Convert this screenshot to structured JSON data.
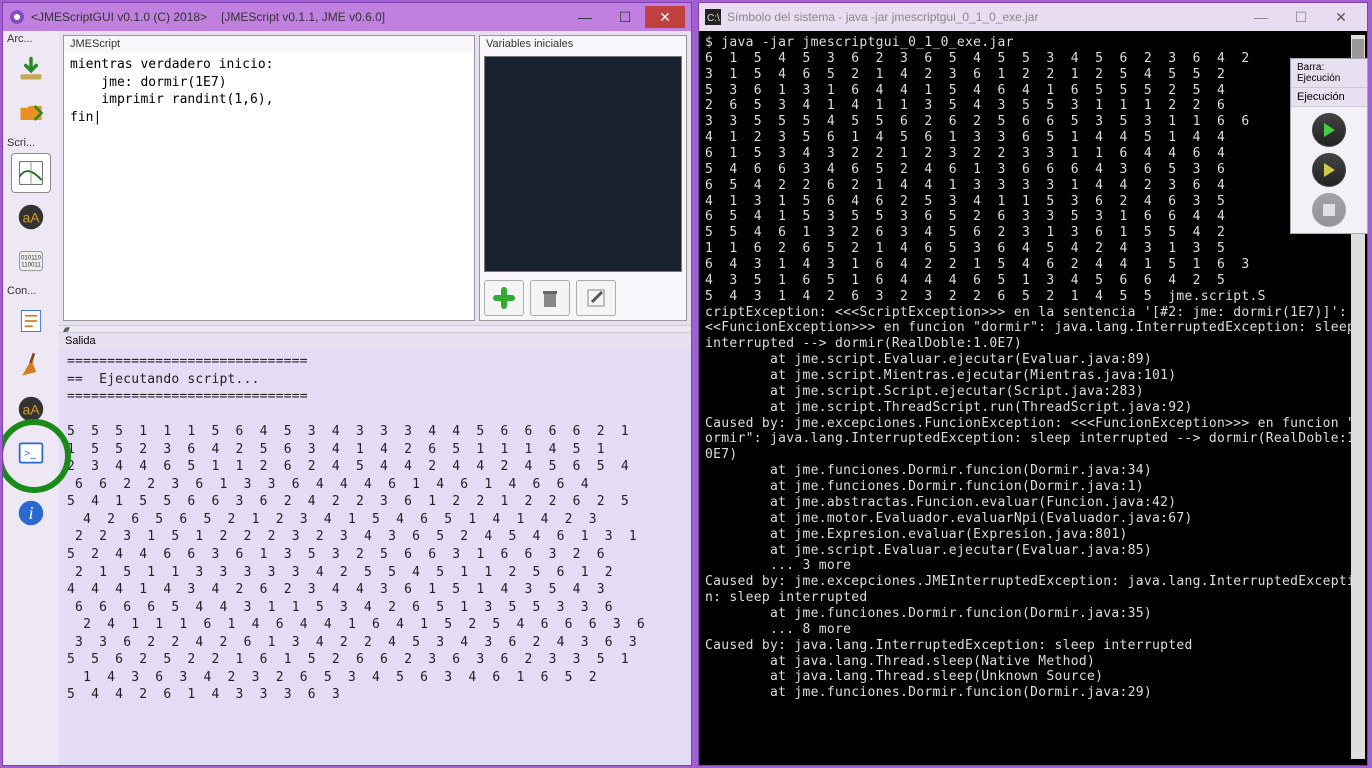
{
  "main_window": {
    "title_left": "<JMEScriptGUI v0.1.0 (C) 2018>",
    "title_right": "[JMEScript v0.1.1, JME v0.6.0]"
  },
  "toolbar": {
    "sec_arc": "Arc...",
    "sec_scri": "Scri...",
    "sec_con": "Con..."
  },
  "code_panel": {
    "label": "JMEScript",
    "content": "mientras verdadero inicio:\n    jme: dormir(1E7)\n    imprimir randint(1,6),\nfin|"
  },
  "vars_panel": {
    "label": "Variables iniciales"
  },
  "output_panel": {
    "label": "Salida",
    "content": "==============================\n==  Ejecutando script...\n==============================\n\n5  5  5  1  1  1  5  6  4  5  3  4  3  3  3  4  4  5  6  6  6  6  2  1\n1  5  5  2  3  6  4  2  5  6  3  4  1  4  2  6  5  1  1  1  4  5  1\n2  3  4  4  6  5  1  1  2  6  2  4  5  4  4  2  4  4  2  4  5  6  5  4\n 6  6  2  2  3  6  1  3  3  6  4  4  4  6  1  4  6  1  4  6  6  4\n5  4  1  5  5  6  6  3  6  2  4  2  2  3  6  1  2  2  1  2  2  6  2  5\n  4  2  6  5  6  5  2  1  2  3  4  1  5  4  6  5  1  4  1  4  2  3\n 2  2  3  1  5  1  2  2  2  3  2  3  4  3  6  5  2  4  5  4  6  1  3  1\n5  2  4  4  6  6  3  6  1  3  5  3  2  5  6  6  3  1  6  6  3  2  6\n 2  1  5  1  1  3  3  3  3  3  4  2  5  5  4  5  1  1  2  5  6  1  2\n4  4  4  1  4  3  4  2  6  2  3  4  4  3  6  1  5  1  4  3  5  4  3\n 6  6  6  6  5  4  4  3  1  1  5  3  4  2  6  5  1  3  5  5  3  3  6\n  2  4  1  1  1  6  1  4  6  4  4  1  6  4  1  5  2  5  4  6  6  6  3  6\n 3  3  6  2  2  4  2  6  1  3  4  2  2  4  5  3  4  3  6  2  4  3  6  3\n5  5  6  2  5  2  2  1  6  1  5  2  6  6  2  3  6  3  6  2  3  3  5  1\n  1  4  3  6  3  4  2  3  2  6  5  3  4  5  6  3  4  6  1  6  5  2\n5  4  4  2  6  1  4  3  3  3  6  3"
  },
  "console_window": {
    "title": "Símbolo del sistema - java  -jar jmescriptgui_0_1_0_exe.jar",
    "content": "$ java -jar jmescriptgui_0_1_0_exe.jar\n6  1  5  4  5  3  6  2  3  6  5  4  5  5  3  4  5  6  2  3  6  4  2\n3  1  5  4  6  5  2  1  4  2  3  6  1  2  2  1  2  5  4  5  5  2\n5  3  6  1  3  1  6  4  4  1  5  4  6  4  1  6  5  5  5  2  5  4\n2  6  5  3  4  1  4  1  1  3  5  4  3  5  5  3  1  1  1  2  2  6\n3  3  5  5  5  4  5  5  6  2  6  2  5  6  6  5  3  5  3  1  1  6  6\n4  1  2  3  5  6  1  4  5  6  1  3  3  6  5  1  4  4  5  1  4  4\n6  1  5  3  4  3  2  2  1  2  3  2  2  3  3  1  1  6  4  4  6  4\n5  4  6  6  3  4  6  5  2  4  6  1  3  6  6  6  4  3  6  5  3  6\n6  5  4  2  2  6  2  1  4  4  1  3  3  3  3  1  4  4  2  3  6  4\n4  1  3  1  5  6  4  6  2  5  3  4  1  1  5  3  6  2  4  6  3  5\n6  5  4  1  5  3  5  5  3  6  5  2  6  3  3  5  3  1  6  6  4  4\n5  5  4  6  1  3  2  6  3  4  5  6  2  3  1  3  6  1  5  5  4  2\n1  1  6  2  6  5  2  1  4  6  5  3  6  4  5  4  2  4  3  1  3  5\n6  4  3  1  4  3  1  6  4  2  2  1  5  4  6  2  4  4  1  5  1  6  3\n4  3  5  1  6  5  1  6  4  4  4  6  5  1  3  4  5  6  6  4  2  5\n5  4  3  1  4  2  6  3  2  3  2  2  6  5  2  1  4  5  5  jme.script.S\ncriptException: <<<ScriptException>>> en la sentencia '[#2: jme: dormir(1E7)]': <\n<<FuncionException>>> en funcion \"dormir\": java.lang.InterruptedException: sleep\ninterrupted --> dormir(RealDoble:1.0E7)\n        at jme.script.Evaluar.ejecutar(Evaluar.java:89)\n        at jme.script.Mientras.ejecutar(Mientras.java:101)\n        at jme.script.Script.ejecutar(Script.java:283)\n        at jme.script.ThreadScript.run(ThreadScript.java:92)\nCaused by: jme.excepciones.FuncionException: <<<FuncionException>>> en funcion \"d\normir\": java.lang.InterruptedException: sleep interrupted --> dormir(RealDoble:1.\n0E7)\n        at jme.funciones.Dormir.funcion(Dormir.java:34)\n        at jme.funciones.Dormir.funcion(Dormir.java:1)\n        at jme.abstractas.Funcion.evaluar(Funcion.java:42)\n        at jme.motor.Evaluador.evaluarNpi(Evaluador.java:67)\n        at jme.Expresion.evaluar(Expresion.java:801)\n        at jme.script.Evaluar.ejecutar(Evaluar.java:85)\n        ... 3 more\nCaused by: jme.excepciones.JMEInterruptedException: java.lang.InterruptedExceptio\nn: sleep interrupted\n        at jme.funciones.Dormir.funcion(Dormir.java:35)\n        ... 8 more\nCaused by: java.lang.InterruptedException: sleep interrupted\n        at java.lang.Thread.sleep(Native Method)\n        at java.lang.Thread.sleep(Unknown Source)\n        at jme.funciones.Dormir.funcion(Dormir.java:29)"
  },
  "float_panel": {
    "barra": "Barra: Ejecución",
    "label": "Ejecución"
  }
}
